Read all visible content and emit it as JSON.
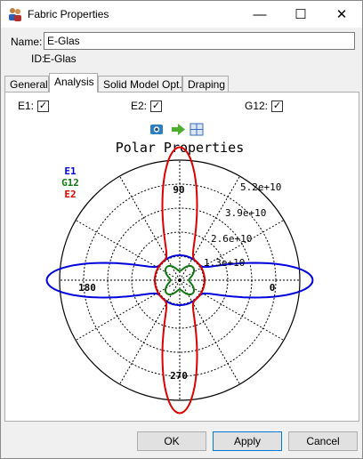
{
  "window": {
    "title": "Fabric Properties",
    "minimize_glyph": "—",
    "maximize_glyph": "☐",
    "close_glyph": "✕",
    "app_icon": "people-icon"
  },
  "form": {
    "name_label": "Name:",
    "name_value": "E-Glas",
    "id_label": "ID:",
    "id_value": "E-Glas"
  },
  "tabs": [
    {
      "label": "General",
      "active": false
    },
    {
      "label": "Analysis",
      "active": true
    },
    {
      "label": "Solid Model Opt.",
      "active": false
    },
    {
      "label": "Draping",
      "active": false
    }
  ],
  "checkboxes": {
    "e1": {
      "label": "E1:",
      "checked": true
    },
    "e2": {
      "label": "E2:",
      "checked": true
    },
    "g12": {
      "label": "G12:",
      "checked": true
    }
  },
  "toolbar_icons": [
    "camera-icon",
    "green-arrow-icon",
    "fit-view-icon"
  ],
  "buttons": {
    "ok": "OK",
    "apply": "Apply",
    "cancel": "Cancel"
  },
  "chart_data": {
    "type": "polar",
    "title": "Polar Properties",
    "legend": [
      "E1",
      "G12",
      "E2"
    ],
    "legend_placement": "top-left",
    "angle_labels": [
      "0",
      "90",
      "180",
      "270"
    ],
    "radial_labels": [
      "1.3e+10",
      "2.6e+10",
      "3.9e+10",
      "5.2e+10"
    ],
    "rmax": 65000000000,
    "grid": true,
    "series": [
      {
        "name": "E1",
        "color": "#0000dd",
        "peak_angle_deg": 0,
        "peak": 72000000000,
        "min": 13500000000
      },
      {
        "name": "G12",
        "color": "#117711",
        "peak_angle_deg": 45,
        "peak": 10000000000,
        "min": 5000000000
      },
      {
        "name": "E2",
        "color": "#dd0000",
        "peak_angle_deg": 90,
        "peak": 72000000000,
        "min": 13500000000
      }
    ]
  }
}
